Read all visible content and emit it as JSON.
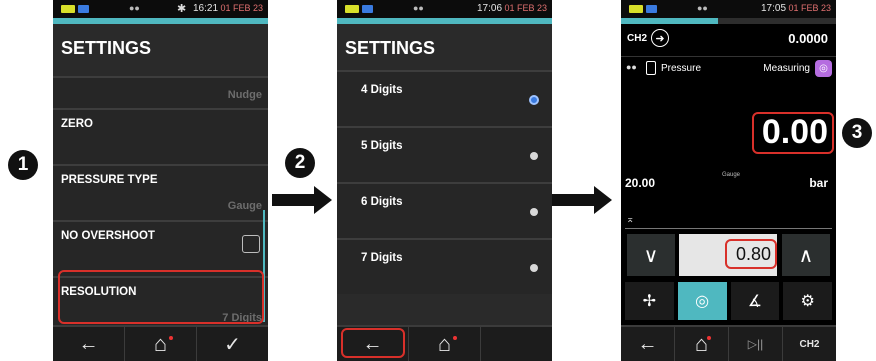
{
  "steps": [
    "1",
    "2",
    "3"
  ],
  "status": {
    "dots": "●●",
    "bt": "✱",
    "time1": "16:21",
    "time2": "17:06",
    "time3": "17:05",
    "date": "01 FEB 23"
  },
  "screen1": {
    "title": "SETTINGS",
    "rows": [
      {
        "label": "",
        "value": "Nudge"
      },
      {
        "label": "ZERO",
        "value": ""
      },
      {
        "label": "PRESSURE TYPE",
        "value": "Gauge"
      },
      {
        "label": "NO OVERSHOOT",
        "value": ""
      },
      {
        "label": "RESOLUTION",
        "value": "7 Digits"
      }
    ]
  },
  "screen2": {
    "title": "SETTINGS",
    "options": [
      "4 Digits",
      "5 Digits",
      "6 Digits",
      "7 Digits"
    ],
    "selected_index": 0
  },
  "screen3": {
    "channel": "CH2",
    "channel_value": "0.0000",
    "sensor_label": "Pressure",
    "mode": "Measuring",
    "reading": "0.00",
    "range_value": "20.00",
    "pressure_type": "Gauge",
    "unit": "bar",
    "setpoint": "0.80",
    "progress_fraction": 0.45
  },
  "icons": {
    "back": "←",
    "home": "⌂",
    "check": "✓",
    "play_pause": "▷||",
    "down": "∨",
    "up": "∧",
    "gear": "⚙"
  },
  "colors": {
    "accent": "#4fb8c0",
    "highlight": "#d8302a",
    "mode_icon": "#b56de0",
    "date": "#e07070"
  }
}
